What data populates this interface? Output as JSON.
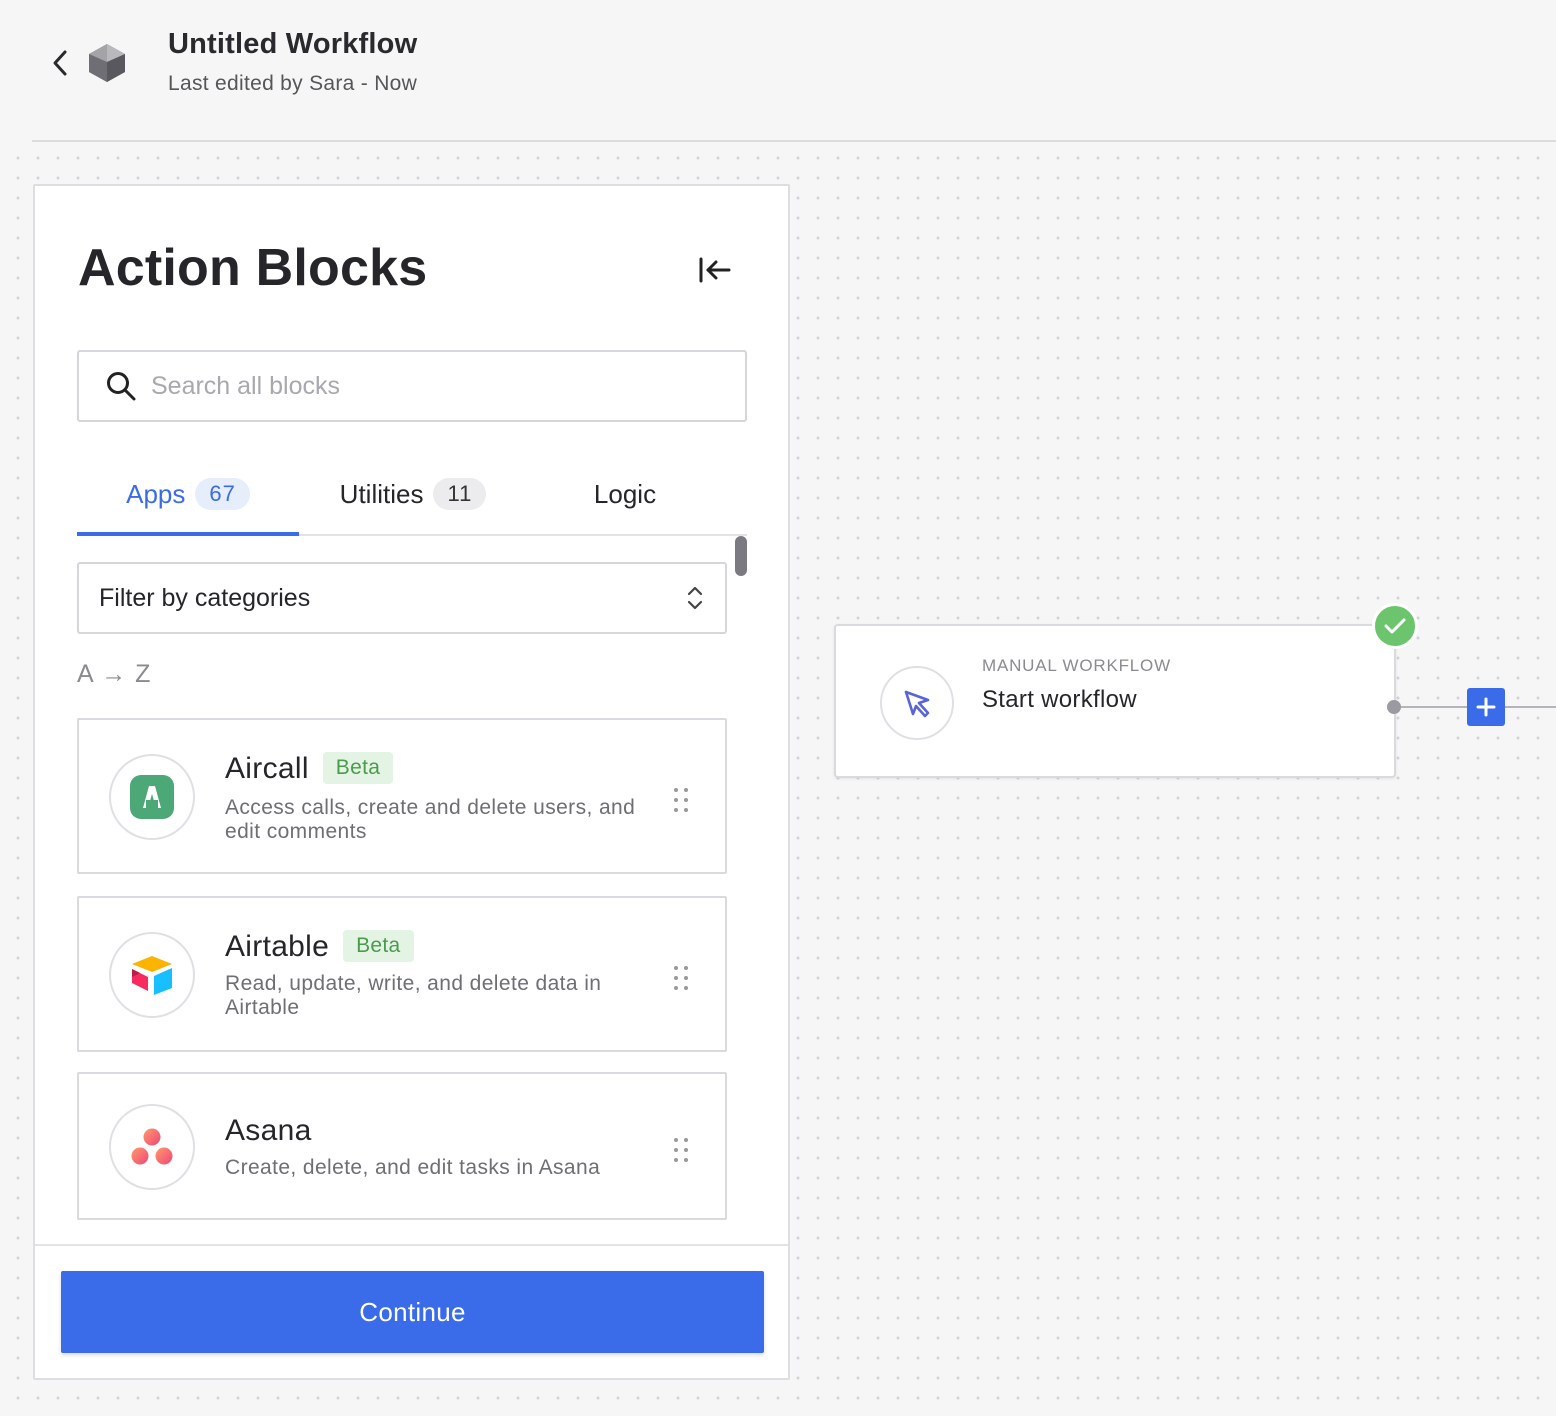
{
  "header": {
    "title": "Untitled Workflow",
    "subtitle": "Last edited by Sara - Now"
  },
  "panel": {
    "title": "Action Blocks",
    "search": {
      "placeholder": "Search all blocks",
      "value": ""
    },
    "tabs": [
      {
        "label": "Apps",
        "count": "67",
        "active": true
      },
      {
        "label": "Utilities",
        "count": "11",
        "active": false
      },
      {
        "label": "Logic",
        "active": false
      }
    ],
    "filter": {
      "label": "Filter by categories"
    },
    "sort_label": "A → Z",
    "items": [
      {
        "name": "Aircall",
        "badge": "Beta",
        "description": "Access calls, create and delete users, and edit comments",
        "icon": "aircall-logo-icon"
      },
      {
        "name": "Airtable",
        "badge": "Beta",
        "description": "Read, update, write, and delete data in Airtable",
        "icon": "airtable-logo-icon"
      },
      {
        "name": "Asana",
        "badge": "",
        "description": "Create, delete, and edit tasks in Asana",
        "icon": "asana-logo-icon"
      }
    ],
    "continue_label": "Continue"
  },
  "node": {
    "kind": "MANUAL WORKFLOW",
    "name": "Start workflow",
    "icon": "cursor-icon",
    "status": "success"
  },
  "colors": {
    "accent": "#3a6be8",
    "success": "#6cc46c",
    "beta_bg": "#e4f4e4",
    "beta_text": "#4c9a4c"
  }
}
